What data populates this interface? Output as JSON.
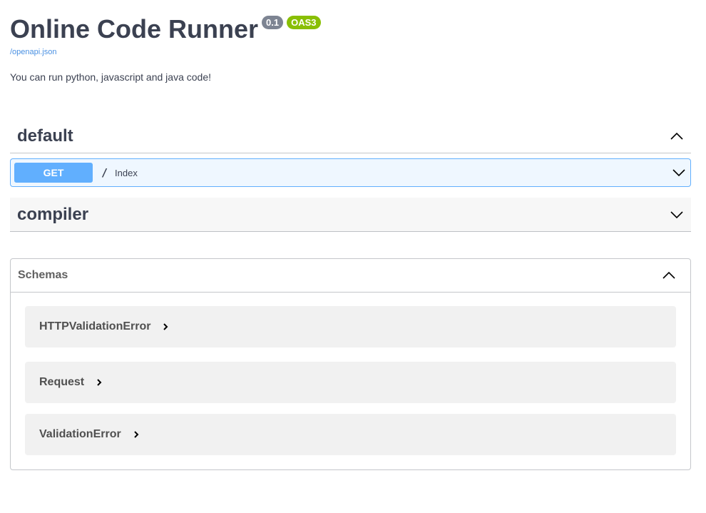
{
  "header": {
    "title": "Online Code Runner",
    "version_badge": "0.1",
    "oas_badge": "OAS3",
    "spec_link": "/openapi.json",
    "description": "You can run python, javascript and java code!"
  },
  "tags": [
    {
      "name": "default",
      "expanded": true,
      "operations": [
        {
          "method": "GET",
          "path": "/",
          "summary": "Index"
        }
      ]
    },
    {
      "name": "compiler",
      "expanded": false
    }
  ],
  "schemas": {
    "title": "Schemas",
    "expanded": true,
    "models": [
      {
        "name": "HTTPValidationError"
      },
      {
        "name": "Request"
      },
      {
        "name": "ValidationError"
      }
    ]
  },
  "colors": {
    "get_method": "#61affe",
    "version_badge": "#7d8492",
    "oas_badge": "#89bf04",
    "link": "#4990e2",
    "text": "#3b4151"
  }
}
